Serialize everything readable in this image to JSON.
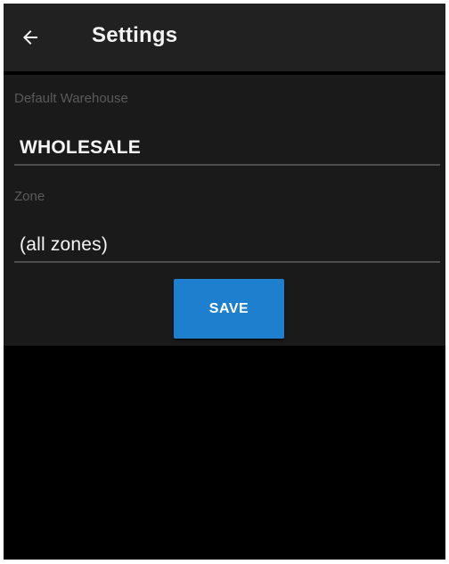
{
  "header": {
    "title": "Settings",
    "back_icon": "arrow-left-icon"
  },
  "form": {
    "warehouse": {
      "label": "Default Warehouse",
      "value": "WHOLESALE"
    },
    "zone": {
      "label": "Zone",
      "value": "(all zones)"
    },
    "save_label": "SAVE"
  },
  "colors": {
    "appbar_background": "#212121",
    "panel_background": "#1a1a1a",
    "screen_background": "#000000",
    "accent_button": "#1e7fcf"
  }
}
